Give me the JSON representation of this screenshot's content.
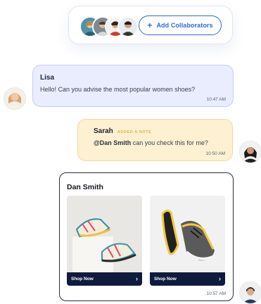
{
  "collaborators": {
    "add_label": "Add Collaborators",
    "avatars": [
      "collaborator-1",
      "collaborator-2",
      "collaborator-3",
      "collaborator-4"
    ]
  },
  "messages": {
    "lisa": {
      "name": "Lisa",
      "text": "Hello! Can you advise the most popular women shoes?",
      "time": "10:47 AM"
    },
    "sarah": {
      "name": "Sarah",
      "tag": "ADDED A NOTE",
      "mention": "@Dan Smith",
      "text": " can you check this for me?",
      "time": "10:50 AM"
    },
    "dan": {
      "name": "Dan Smith",
      "products": [
        {
          "button_label": "Shop Now"
        },
        {
          "button_label": "Shop Now"
        }
      ],
      "time": "10:57 AM"
    }
  },
  "colors": {
    "accent": "#2f67e0",
    "lisa_bubble": "#e9edfd",
    "sarah_bubble": "#fdf1d2",
    "shop_button": "#0f1b3d"
  }
}
